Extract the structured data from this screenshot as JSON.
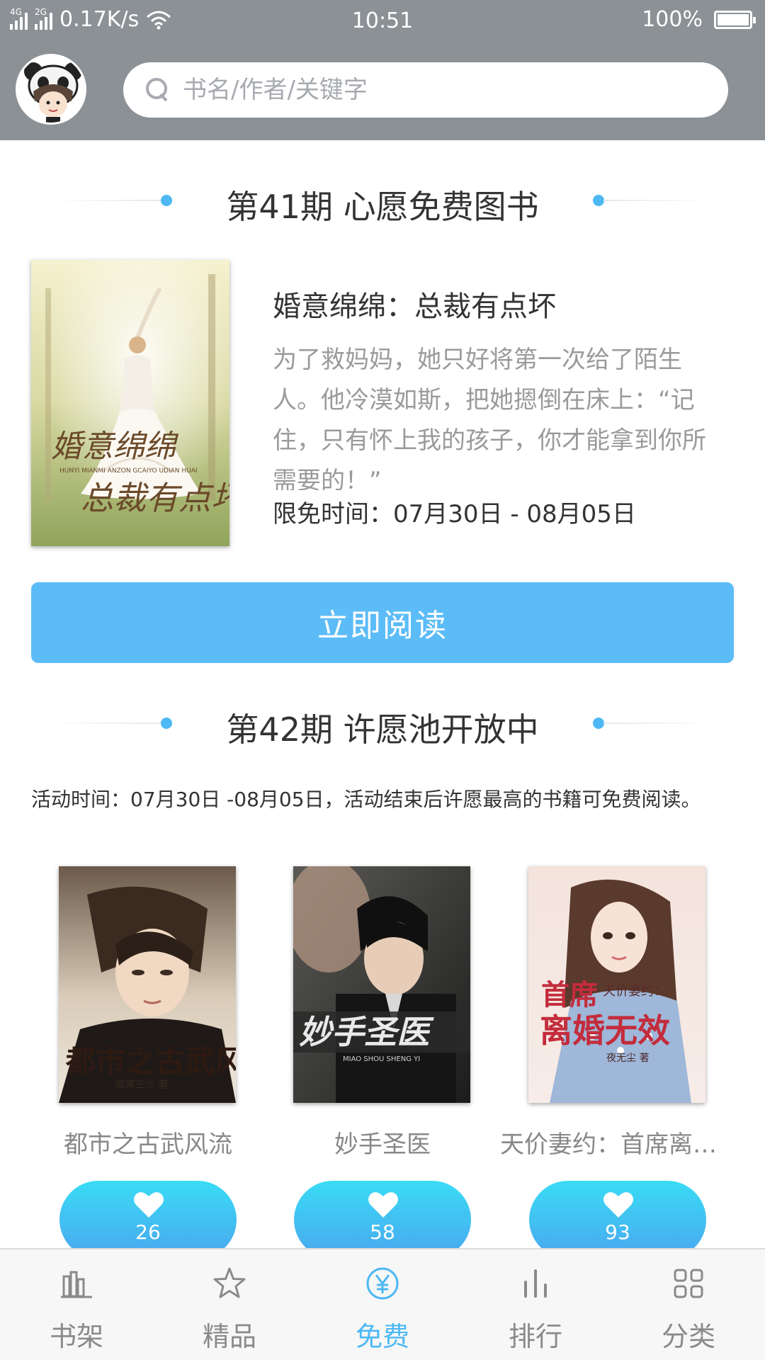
{
  "status_bar": {
    "network_1": "4G",
    "network_2": "2G",
    "speed": "0.17K/s",
    "time": "10:51",
    "battery": "100%"
  },
  "search": {
    "placeholder": "书名/作者/关键字"
  },
  "featured": {
    "section_title": "第41期 心愿免费图书",
    "book_title": "婚意绵绵：总裁有点坏",
    "description": "为了救妈妈，她只好将第一次给了陌生人。他冷漠如斯，把她摁倒在床上：“记住，只有怀上我的孩子，你才能拿到你所需要的！”",
    "free_time": "限免时间：07月30日 - 08月05日",
    "read_button": "立即阅读",
    "cover": {
      "title_text": "婚意绵绵：总裁有点坏",
      "pinyin": "HUNYI MIANMI ANZON GCAIYO UDIAN HUAI"
    }
  },
  "wish_pool": {
    "section_title": "第42期 许愿池开放中",
    "activity_text": "活动时间：07月30日 -08月05日，活动结束后许愿最高的书籍可免费阅读。",
    "books": [
      {
        "name": "都市之古武风流",
        "likes": "26",
        "cover_title": "都市之古武风流",
        "cover_author": "梁家三少 著"
      },
      {
        "name": "妙手圣医",
        "likes": "58",
        "cover_title": "妙手圣医",
        "cover_author": "MIAO SHOU SHENG YI"
      },
      {
        "name": "天价妻约：首席离婚无效",
        "likes": "93",
        "cover_title": "首席离婚无效",
        "cover_subtitle": "天价妻约：",
        "cover_author": "夜无尘 著"
      }
    ]
  },
  "bottom_nav": {
    "items": [
      {
        "label": "书架",
        "icon": "bookshelf-icon"
      },
      {
        "label": "精品",
        "icon": "star-icon"
      },
      {
        "label": "免费",
        "icon": "yen-icon"
      },
      {
        "label": "排行",
        "icon": "bar-chart-icon"
      },
      {
        "label": "分类",
        "icon": "grid-icon"
      }
    ],
    "active_index": 2
  },
  "colors": {
    "accent": "#4db8f4",
    "header_bg": "#8c9196",
    "button": "#5cbcf7",
    "like_gradient_top": "#39dcf5",
    "like_gradient_bottom": "#4aa6ef"
  }
}
